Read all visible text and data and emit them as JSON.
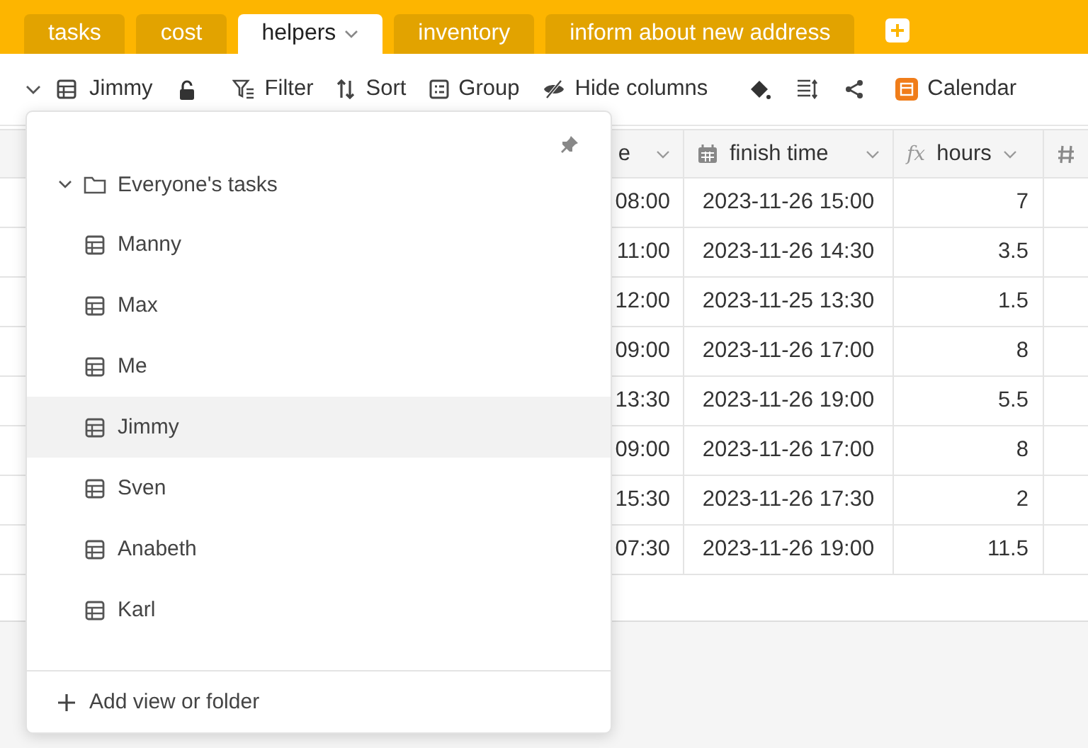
{
  "tabs": [
    {
      "label": "tasks",
      "selected": false
    },
    {
      "label": "cost",
      "selected": false
    },
    {
      "label": "helpers",
      "selected": true
    },
    {
      "label": "inventory",
      "selected": false
    },
    {
      "label": "inform about new address",
      "selected": false
    }
  ],
  "toolbar": {
    "view": "Jimmy",
    "filter": "Filter",
    "sort": "Sort",
    "group": "Group",
    "hide": "Hide columns",
    "calendar": "Calendar"
  },
  "table": {
    "columns": [
      {
        "label": "e",
        "kind": "partial"
      },
      {
        "label": "finish time",
        "kind": "date"
      },
      {
        "label": "hours",
        "kind": "formula",
        "icon_text": "fx"
      },
      {
        "kind": "number"
      }
    ],
    "rows": [
      [
        "08:00",
        "2023-11-26 15:00",
        "7"
      ],
      [
        "11:00",
        "2023-11-26 14:30",
        "3.5"
      ],
      [
        "12:00",
        "2023-11-25 13:30",
        "1.5"
      ],
      [
        "09:00",
        "2023-11-26 17:00",
        "8"
      ],
      [
        "13:30",
        "2023-11-26 19:00",
        "5.5"
      ],
      [
        "09:00",
        "2023-11-26 17:00",
        "8"
      ],
      [
        "15:30",
        "2023-11-26 17:30",
        "2"
      ],
      [
        "07:30",
        "2023-11-26 19:00",
        "11.5"
      ]
    ]
  },
  "view_menu": {
    "folder": {
      "label": "Everyone's tasks",
      "expanded": true,
      "children": [
        {
          "label": "Manny",
          "selected": false
        },
        {
          "label": "Max",
          "selected": false
        },
        {
          "label": "Me",
          "selected": false
        },
        {
          "label": "Jimmy",
          "selected": true
        },
        {
          "label": "Sven",
          "selected": false
        },
        {
          "label": "Anabeth",
          "selected": false
        },
        {
          "label": "Karl",
          "selected": false
        }
      ]
    },
    "add": "Add view or folder"
  }
}
